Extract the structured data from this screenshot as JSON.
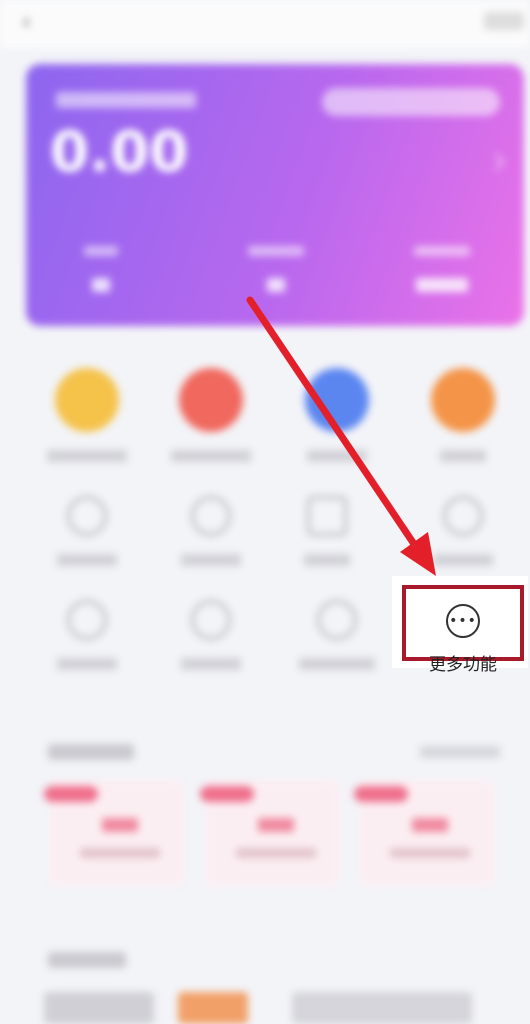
{
  "highlight": {
    "icon": "more-dots-icon",
    "icon_glyph": "•••",
    "label": "更多功能",
    "border_color": "#a8192a"
  },
  "arrow": {
    "color": "#e3202a"
  },
  "card": {
    "balance": "0.00",
    "gradient_start": "#8d66ef",
    "gradient_end": "#ea72e8"
  },
  "top_icons": [
    {
      "name": "yellow-icon",
      "color": "#f5c24a"
    },
    {
      "name": "red-icon",
      "color": "#f0685e"
    },
    {
      "name": "blue-icon",
      "color": "#5b86f0"
    },
    {
      "name": "orange-icon",
      "color": "#f49448"
    }
  ]
}
